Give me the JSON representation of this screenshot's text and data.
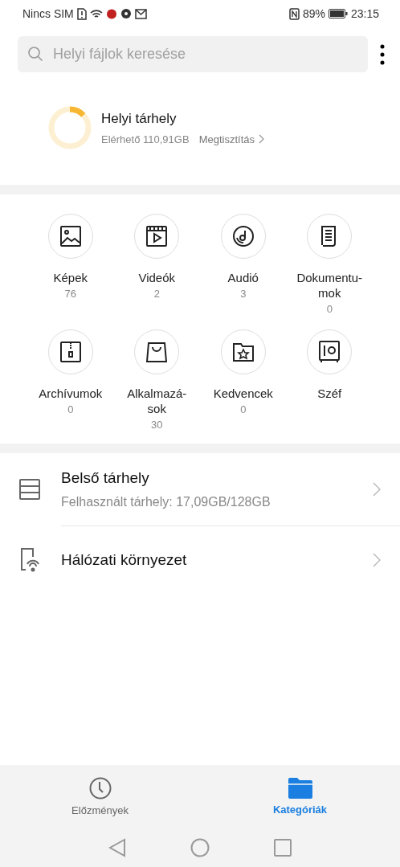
{
  "status_bar": {
    "carrier": "Nincs SIM",
    "battery_text": "89%",
    "time": "23:15"
  },
  "search": {
    "placeholder": "Helyi fájlok keresése"
  },
  "storage": {
    "title": "Helyi tárhely",
    "available": "Elérhető 110,91GB",
    "clean": "Megtisztítás"
  },
  "categories": [
    {
      "kind": "images",
      "label": "Képek",
      "count": "76"
    },
    {
      "kind": "videos",
      "label": "Videók",
      "count": "2"
    },
    {
      "kind": "audio",
      "label": "Audió",
      "count": "3"
    },
    {
      "kind": "documents",
      "label": "Dokumentu-\nmok",
      "count": "0"
    },
    {
      "kind": "archives",
      "label": "Archívumok",
      "count": "0"
    },
    {
      "kind": "apps",
      "label": "Alkalmazá-\nsok",
      "count": "30"
    },
    {
      "kind": "favorites",
      "label": "Kedvencek",
      "count": "0"
    },
    {
      "kind": "safe",
      "label": "Széf"
    }
  ],
  "locations": [
    {
      "kind": "internal",
      "title": "Belső tárhely",
      "subtitle": "Felhasznált tárhely: 17,09GB/128GB"
    },
    {
      "kind": "network",
      "title": "Hálózati környezet"
    }
  ],
  "bottom_tabs": [
    {
      "kind": "history",
      "label": "Előzmények",
      "selected": false
    },
    {
      "kind": "categories",
      "label": "Kategóriák",
      "selected": true
    }
  ]
}
